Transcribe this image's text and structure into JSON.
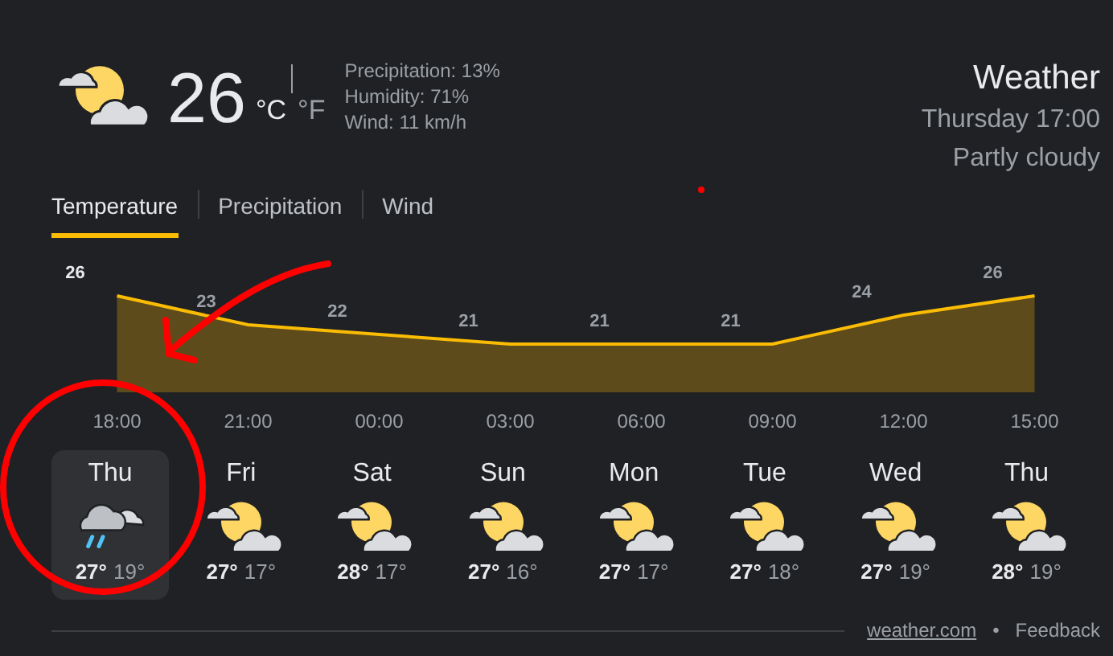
{
  "current": {
    "kind": "partly_cloudy",
    "temperature": "26",
    "units": [
      {
        "label": "°C",
        "selected": true
      },
      {
        "label": "°F",
        "selected": false
      }
    ],
    "details": [
      "Precipitation: 13%",
      "Humidity: 71%",
      "Wind: 11 km/h"
    ]
  },
  "header": {
    "title": "Weather",
    "time": "Thursday 17:00",
    "condition": "Partly cloudy"
  },
  "tabs": [
    {
      "label": "Temperature",
      "selected": true
    },
    {
      "label": "Precipitation",
      "selected": false
    },
    {
      "label": "Wind",
      "selected": false
    }
  ],
  "chart_data": {
    "type": "area",
    "categories": [
      "18:00",
      "21:00",
      "00:00",
      "03:00",
      "06:00",
      "09:00",
      "12:00",
      "15:00"
    ],
    "series": [
      {
        "color": "#fbbc04",
        "values": [
          26,
          23,
          22,
          21,
          21,
          21,
          24,
          26
        ]
      }
    ],
    "data_labels": true
  },
  "days": [
    {
      "day": "Thu",
      "kind": "rain",
      "high": "27°",
      "low": "19°",
      "selected": true
    },
    {
      "day": "Fri",
      "kind": "partly_cloudy",
      "high": "27°",
      "low": "17°",
      "selected": false
    },
    {
      "day": "Sat",
      "kind": "partly_cloudy",
      "high": "28°",
      "low": "17°",
      "selected": false
    },
    {
      "day": "Sun",
      "kind": "partly_cloudy",
      "high": "27°",
      "low": "16°",
      "selected": false
    },
    {
      "day": "Mon",
      "kind": "partly_cloudy",
      "high": "27°",
      "low": "17°",
      "selected": false
    },
    {
      "day": "Tue",
      "kind": "partly_cloudy",
      "high": "27°",
      "low": "18°",
      "selected": false
    },
    {
      "day": "Wed",
      "kind": "partly_cloudy",
      "high": "27°",
      "low": "19°",
      "selected": false
    },
    {
      "day": "Thu",
      "kind": "partly_cloudy",
      "high": "28°",
      "low": "19°",
      "selected": false
    }
  ],
  "footer": {
    "source": "weather.com",
    "separator": "•",
    "feedback": "Feedback"
  }
}
